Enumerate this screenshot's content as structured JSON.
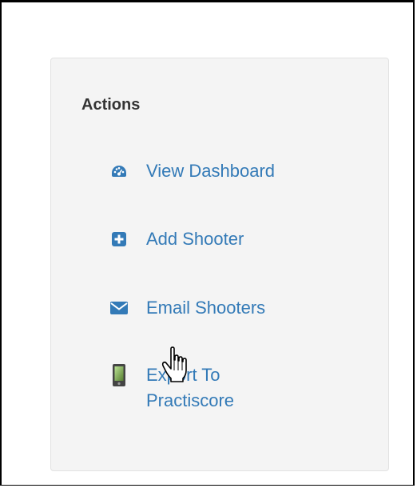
{
  "actions_panel": {
    "title": "Actions",
    "items": [
      {
        "label": "View Dashboard",
        "icon": "dashboard-icon"
      },
      {
        "label": "Add Shooter",
        "icon": "plus-square-icon"
      },
      {
        "label": "Email Shooters",
        "icon": "envelope-icon"
      },
      {
        "label": "Export To Practiscore",
        "icon": "mobile-phone-icon"
      }
    ]
  },
  "colors": {
    "link": "#337ab7",
    "panel_bg": "#f4f4f4",
    "title": "#333333"
  },
  "cursor": {
    "icon": "hand-pointer-cursor-icon"
  }
}
